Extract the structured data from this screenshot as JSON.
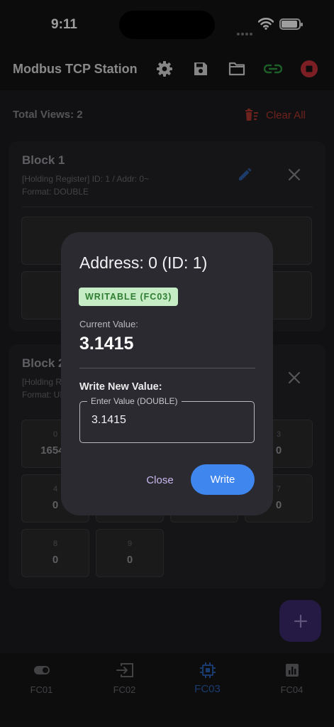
{
  "status_bar": {
    "time": "9:11"
  },
  "appbar": {
    "title": "Modbus TCP Station",
    "icons": [
      "gear-icon",
      "save-icon",
      "folder-icon",
      "link-icon",
      "stop-icon"
    ],
    "link_color": "#2e9b42",
    "stop_color": "#c8323a"
  },
  "summary": {
    "total_views": "Total Views: 2",
    "clear_all": "Clear All"
  },
  "block1": {
    "title": "Block 1",
    "subtitle": "[Holding Register] ID: 1 / Addr: 0~",
    "format": "Format: DOUBLE"
  },
  "block2": {
    "title": "Block 2",
    "subtitle": "[Holding Register] ID: 1 / Addr: 0~",
    "format": "Format: UINT16",
    "cells": [
      {
        "index": "0",
        "value": "16544"
      },
      {
        "index": "3",
        "value": "0"
      },
      {
        "index": "4",
        "value": "0"
      },
      {
        "index": "7",
        "value": "0"
      },
      {
        "index": "8",
        "value": "0"
      },
      {
        "index": "9",
        "value": "0"
      }
    ]
  },
  "dialog": {
    "title": "Address: 0 (ID: 1)",
    "badge": "WRITABLE (FC03)",
    "current_label": "Current Value:",
    "current_value": "3.1415",
    "write_label": "Write New Value:",
    "input_label": "Enter Value (DOUBLE)",
    "input_value": "3.1415",
    "close": "Close",
    "write": "Write"
  },
  "nav": {
    "items": [
      {
        "label": "FC01",
        "icon": "toggle-icon"
      },
      {
        "label": "FC02",
        "icon": "input-icon"
      },
      {
        "label": "FC03",
        "icon": "chip-icon",
        "active": true
      },
      {
        "label": "FC04",
        "icon": "chart-icon"
      }
    ],
    "active_color": "#2b5fb0"
  }
}
